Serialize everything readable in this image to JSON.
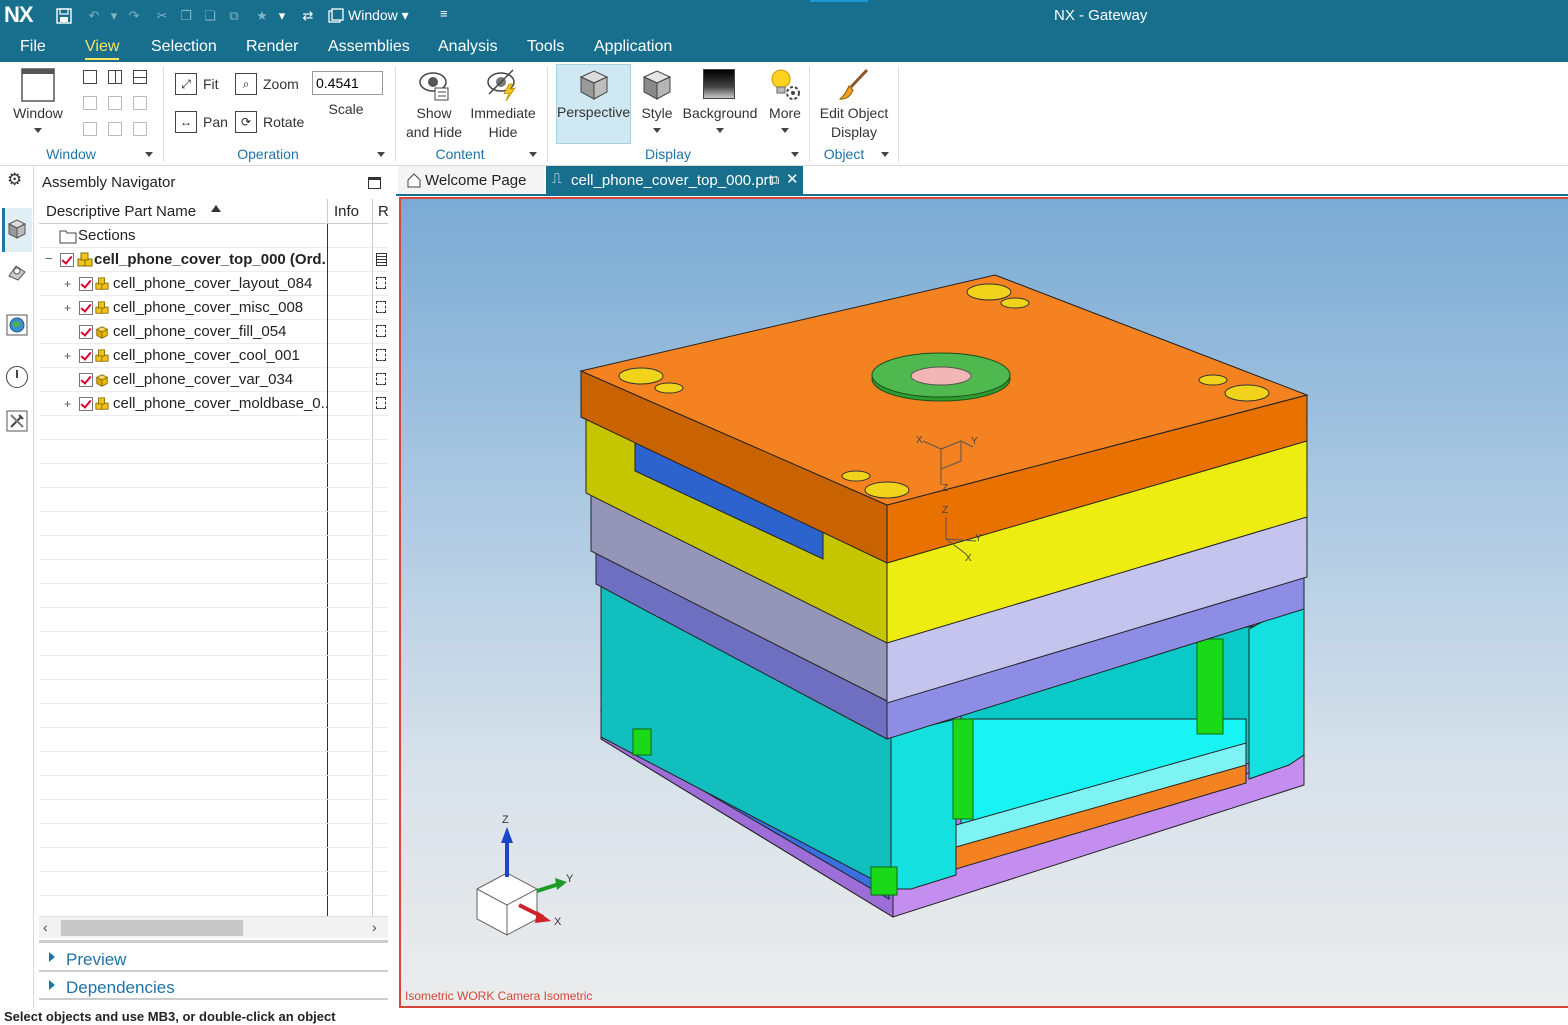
{
  "app": {
    "logo": "NX",
    "title": "NX - Gateway",
    "window_menu": "Window"
  },
  "menus": [
    "File",
    "View",
    "Selection",
    "Render",
    "Assemblies",
    "Analysis",
    "Tools",
    "Application"
  ],
  "active_menu": "View",
  "ribbon": {
    "window_btn": "Window",
    "window_group": "Window",
    "fit": "Fit",
    "zoom": "Zoom",
    "pan": "Pan",
    "rotate": "Rotate",
    "scale_value": "0.4541",
    "scale_label": "Scale",
    "operation_group": "Operation",
    "show_hide_1": "Show",
    "show_hide_2": "and Hide",
    "immediate_hide_1": "Immediate",
    "immediate_hide_2": "Hide",
    "content_group": "Content",
    "perspective": "Perspective",
    "style": "Style",
    "background": "Background",
    "more": "More",
    "display_group": "Display",
    "edit_object_1": "Edit Object",
    "edit_object_2": "Display",
    "object_group": "Object"
  },
  "navigator": {
    "title": "Assembly Navigator",
    "col_name": "Descriptive Part Name",
    "col_info": "Info",
    "col_r": "R",
    "sections": "Sections",
    "root": "cell_phone_cover_top_000 (Ord...",
    "items": [
      {
        "name": "cell_phone_cover_layout_084",
        "expandable": true,
        "assembly": true
      },
      {
        "name": "cell_phone_cover_misc_008",
        "expandable": true,
        "assembly": true
      },
      {
        "name": "cell_phone_cover_fill_054",
        "expandable": false,
        "assembly": false
      },
      {
        "name": "cell_phone_cover_cool_001",
        "expandable": true,
        "assembly": true
      },
      {
        "name": "cell_phone_cover_var_034",
        "expandable": false,
        "assembly": false
      },
      {
        "name": "cell_phone_cover_moldbase_0...",
        "expandable": true,
        "assembly": true
      }
    ],
    "preview": "Preview",
    "dependencies": "Dependencies"
  },
  "tabs": {
    "welcome": "Welcome Page",
    "part": "cell_phone_cover_top_000.prt"
  },
  "viewport": {
    "view_label": "Isometric WORK Camera Isometric",
    "axis_x": "X",
    "axis_y": "Y",
    "axis_z": "Z"
  },
  "status": "Select objects and use MB3, or double-click an object",
  "colors": {
    "title_bar": "#176f8d",
    "accent_active": "#f9e265",
    "group_label": "#1f73a6",
    "plate_top": "#f58220",
    "plate_yellow": "#eded12",
    "plate_lavender": "#c4c4ee",
    "plate_blue": "#8d8de6",
    "plate_cyan": "#14e0e0",
    "plate_purple": "#c48ef0",
    "pins": "#19d919"
  }
}
